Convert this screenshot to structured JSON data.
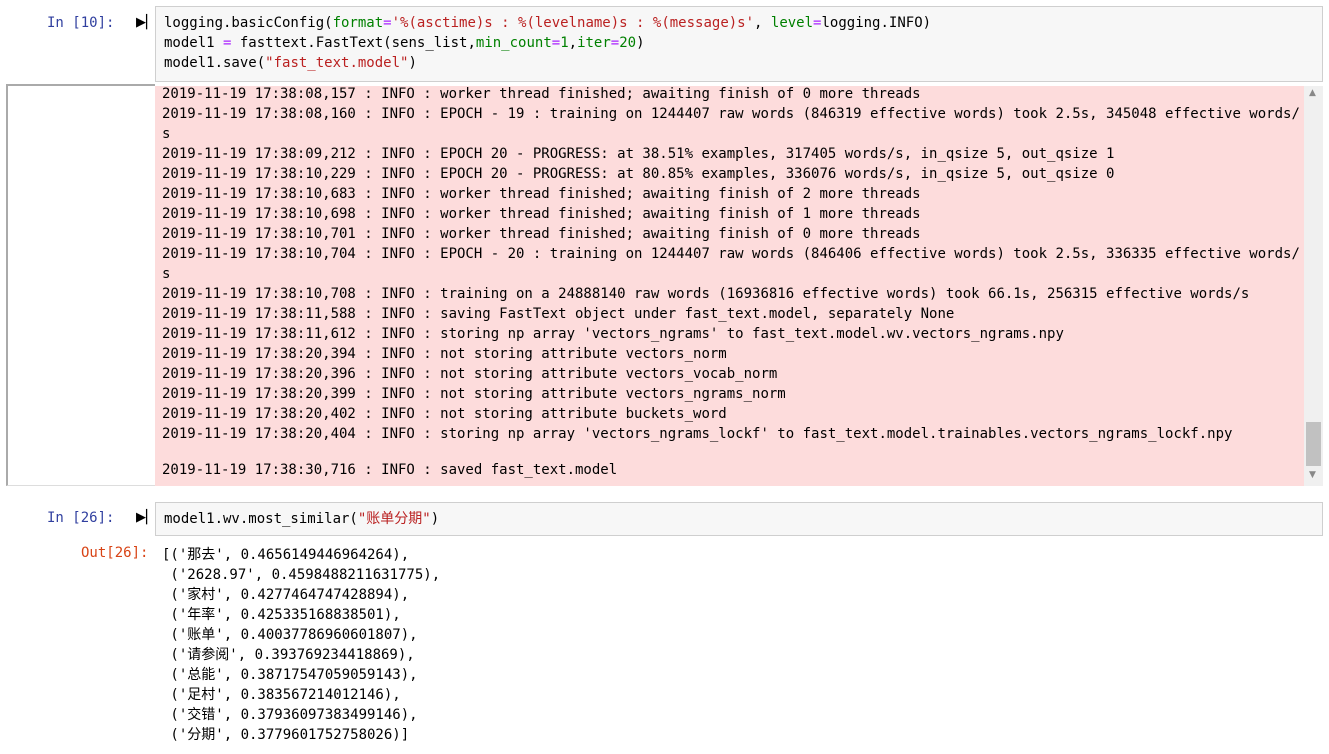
{
  "cell1": {
    "prompt": "In [10]:",
    "code": [
      {
        "parts": [
          {
            "t": "logging.basicConfig(",
            "c": ""
          },
          {
            "t": "format",
            "c": "kw"
          },
          {
            "t": "=",
            "c": "eq"
          },
          {
            "t": "'%(asctime)s : %(levelname)s : %(message)s'",
            "c": "str"
          },
          {
            "t": ", ",
            "c": ""
          },
          {
            "t": "level",
            "c": "kw"
          },
          {
            "t": "=",
            "c": "eq"
          },
          {
            "t": "logging.INFO)",
            "c": ""
          }
        ]
      },
      {
        "parts": [
          {
            "t": "model1 ",
            "c": ""
          },
          {
            "t": "=",
            "c": "eq"
          },
          {
            "t": " fasttext.FastText(sens_list,",
            "c": ""
          },
          {
            "t": "min_count",
            "c": "kw"
          },
          {
            "t": "=",
            "c": "eq"
          },
          {
            "t": "1",
            "c": "num"
          },
          {
            "t": ",",
            "c": ""
          },
          {
            "t": "iter",
            "c": "kw"
          },
          {
            "t": "=",
            "c": "eq"
          },
          {
            "t": "20",
            "c": "num"
          },
          {
            "t": ")",
            "c": ""
          }
        ]
      },
      {
        "parts": [
          {
            "t": "model1.save(",
            "c": ""
          },
          {
            "t": "\"fast_text.model\"",
            "c": "str"
          },
          {
            "t": ")",
            "c": ""
          }
        ]
      }
    ],
    "log": [
      "2019-11-19 17:38:08,157 : INFO : worker thread finished; awaiting finish of 0 more threads",
      "2019-11-19 17:38:08,160 : INFO : EPOCH - 19 : training on 1244407 raw words (846319 effective words) took 2.5s, 345048 effective words/",
      "s",
      "2019-11-19 17:38:09,212 : INFO : EPOCH 20 - PROGRESS: at 38.51% examples, 317405 words/s, in_qsize 5, out_qsize 1",
      "2019-11-19 17:38:10,229 : INFO : EPOCH 20 - PROGRESS: at 80.85% examples, 336076 words/s, in_qsize 5, out_qsize 0",
      "2019-11-19 17:38:10,683 : INFO : worker thread finished; awaiting finish of 2 more threads",
      "2019-11-19 17:38:10,698 : INFO : worker thread finished; awaiting finish of 1 more threads",
      "2019-11-19 17:38:10,701 : INFO : worker thread finished; awaiting finish of 0 more threads",
      "2019-11-19 17:38:10,704 : INFO : EPOCH - 20 : training on 1244407 raw words (846406 effective words) took 2.5s, 336335 effective words/",
      "s",
      "2019-11-19 17:38:10,708 : INFO : training on a 24888140 raw words (16936816 effective words) took 66.1s, 256315 effective words/s",
      "2019-11-19 17:38:11,588 : INFO : saving FastText object under fast_text.model, separately None",
      "2019-11-19 17:38:11,612 : INFO : storing np array 'vectors_ngrams' to fast_text.model.wv.vectors_ngrams.npy",
      "2019-11-19 17:38:20,394 : INFO : not storing attribute vectors_norm",
      "2019-11-19 17:38:20,396 : INFO : not storing attribute vectors_vocab_norm",
      "2019-11-19 17:38:20,399 : INFO : not storing attribute vectors_ngrams_norm",
      "2019-11-19 17:38:20,402 : INFO : not storing attribute buckets_word",
      "2019-11-19 17:38:20,404 : INFO : storing np array 'vectors_ngrams_lockf' to fast_text.model.trainables.vectors_ngrams_lockf.npy",
      "2019-11-19 17:38:30,716 : INFO : saved fast_text.model"
    ]
  },
  "cell2": {
    "prompt": "In [26]:",
    "code": [
      {
        "parts": [
          {
            "t": "model1.wv.most_similar(",
            "c": ""
          },
          {
            "t": "\"账单分期\"",
            "c": "str"
          },
          {
            "t": ")",
            "c": ""
          }
        ]
      }
    ],
    "out_prompt": "Out[26]:",
    "output": [
      "[('那去', 0.4656149446964264),",
      " ('2628.97', 0.4598488211631775),",
      " ('家村', 0.4277464747428894),",
      " ('年率', 0.425335168838501),",
      " ('账单', 0.40037786960601807),",
      " ('请参阅', 0.393769234418869),",
      " ('总能', 0.38717547059059143),",
      " ('足村', 0.383567214012146),",
      " ('交错', 0.37936097383499146),",
      " ('分期', 0.3779601752758026)]"
    ]
  },
  "icons": {
    "run": "run-cell-icon"
  },
  "colors": {
    "stderr_bg": "#fddcdc",
    "prompt": "#303f9f",
    "out_prompt": "#d84315",
    "string": "#ba2121",
    "keyword": "#008000"
  }
}
